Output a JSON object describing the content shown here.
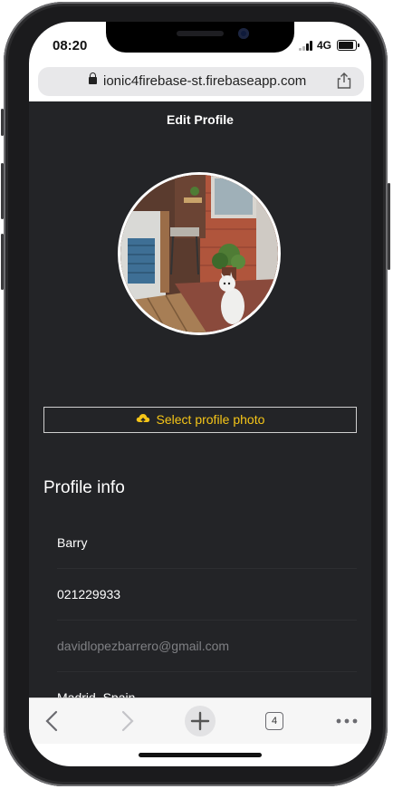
{
  "status_bar": {
    "time": "08:20",
    "network": "4G"
  },
  "browser": {
    "url": "ionic4firebase-st.firebaseapp.com",
    "tab_count": "4"
  },
  "page": {
    "title": "Edit Profile",
    "select_photo_label": "Select profile photo",
    "section_title": "Profile info"
  },
  "profile_fields": {
    "name": "Barry",
    "phone": "021229933",
    "email": "davidlopezbarrero@gmail.com",
    "location": "Madrid, Spain"
  },
  "colors": {
    "app_background": "#232427",
    "accent": "#f5c518",
    "muted_text": "#7f8084"
  },
  "icons": [
    "lock-icon",
    "share-icon",
    "cloud-upload-icon",
    "back-icon",
    "forward-icon",
    "new-tab-icon",
    "tabs-icon",
    "more-icon"
  ]
}
